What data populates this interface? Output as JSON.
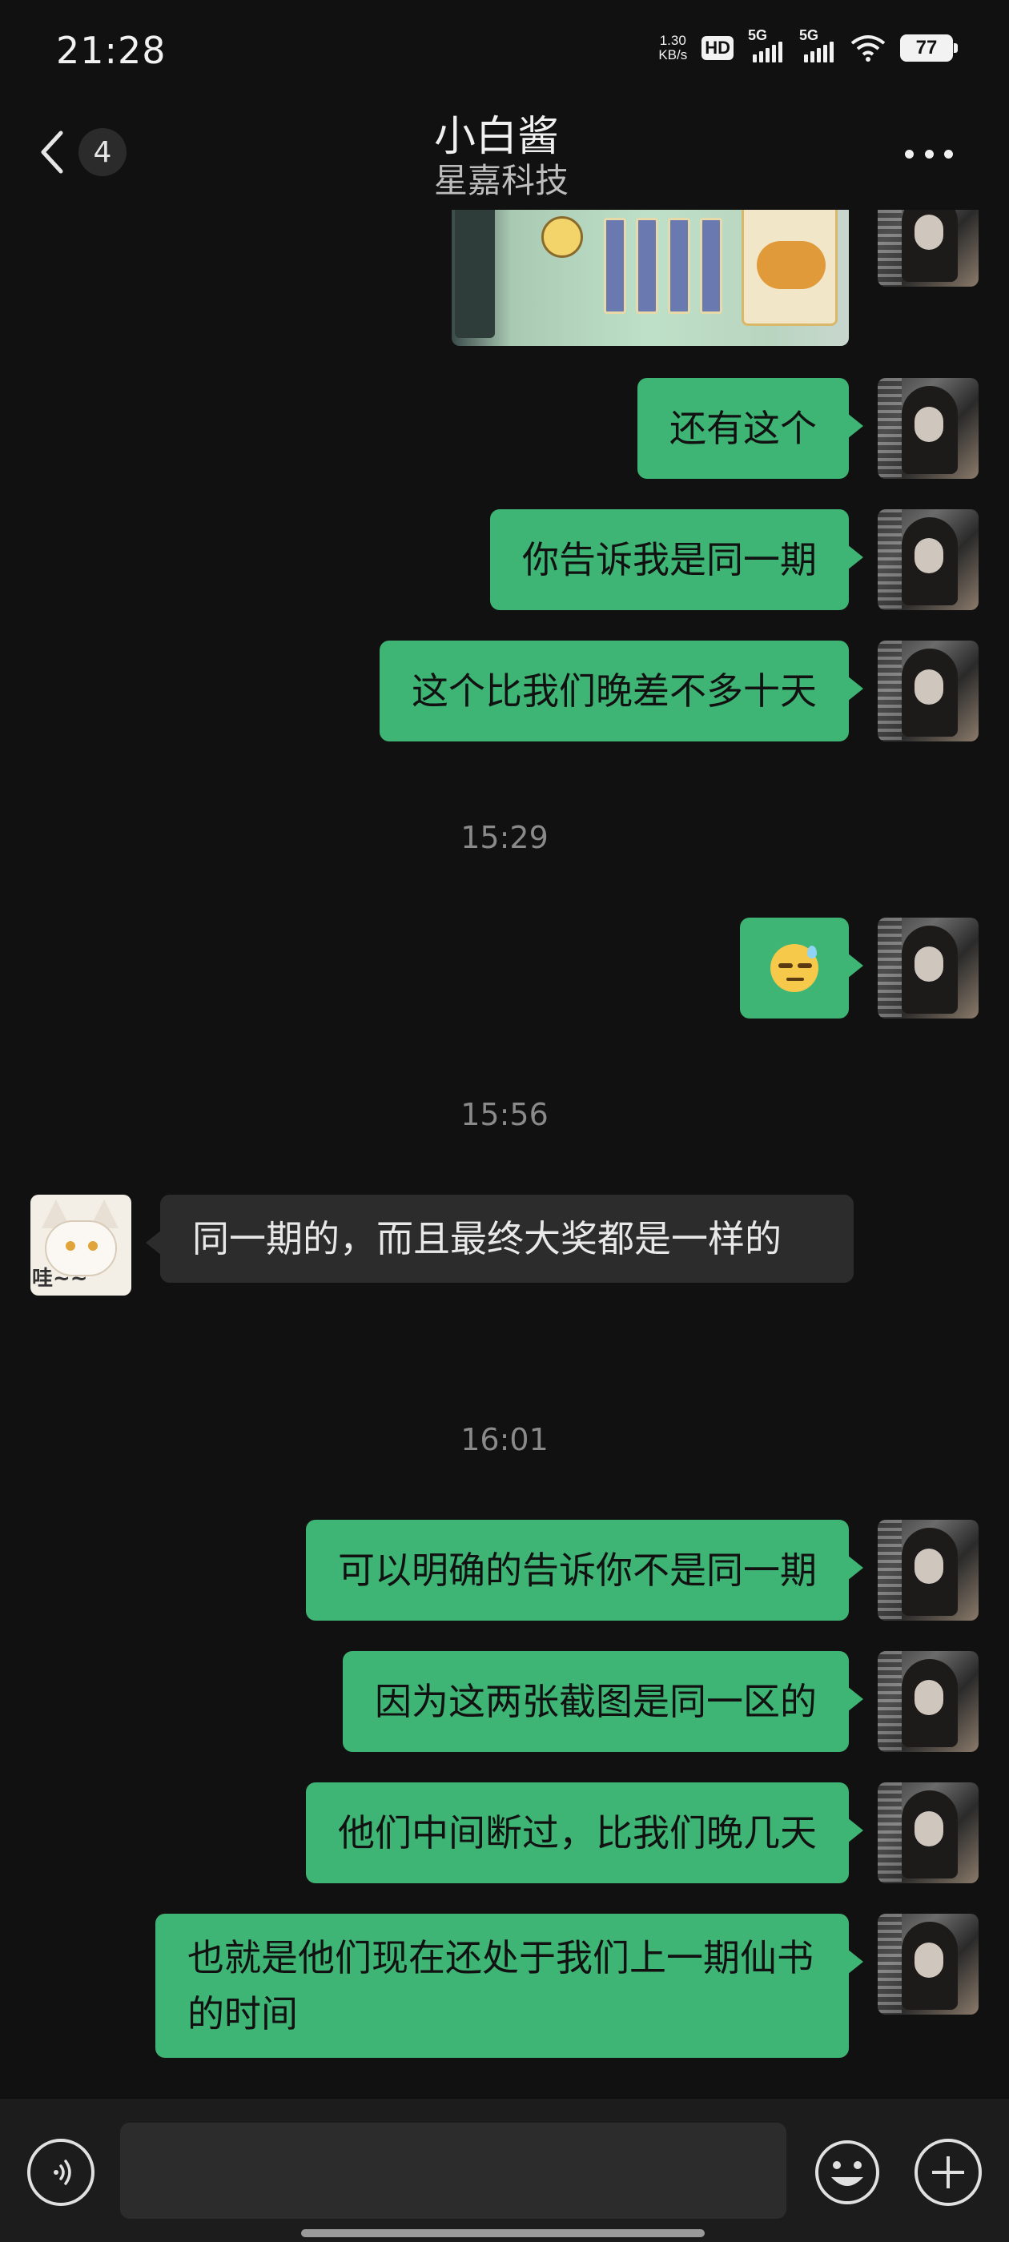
{
  "status_bar": {
    "time": "21:28",
    "net_speed_value": "1.30",
    "net_speed_unit": "KB/s",
    "hd_label": "HD",
    "sim1_label": "5G",
    "sim2_label": "5G",
    "battery": "77"
  },
  "header": {
    "unread_count": "4",
    "title": "小白酱",
    "subtitle": "星嘉科技"
  },
  "messages": [
    {
      "type": "image",
      "from": "me",
      "description_icon": "game-screenshot-image"
    },
    {
      "type": "text",
      "from": "me",
      "text": "还有这个"
    },
    {
      "type": "text",
      "from": "me",
      "text": "你告诉我是同一期"
    },
    {
      "type": "text",
      "from": "me",
      "text": "这个比我们晚差不多十天"
    },
    {
      "type": "time",
      "text": "15:29"
    },
    {
      "type": "emoji",
      "from": "me",
      "icon": "sweat-smile-emoji-icon"
    },
    {
      "type": "time",
      "text": "15:56"
    },
    {
      "type": "text",
      "from": "other",
      "text": "同一期的，而且最终大奖都是一样的"
    },
    {
      "type": "time",
      "text": "16:01"
    },
    {
      "type": "text",
      "from": "me",
      "text": "可以明确的告诉你不是同一期"
    },
    {
      "type": "text",
      "from": "me",
      "text": "因为这两张截图是同一区的"
    },
    {
      "type": "text",
      "from": "me",
      "text": "他们中间断过，比我们晚几天"
    },
    {
      "type": "text",
      "from": "me",
      "text": "也就是他们现在还处于我们上一期仙书的时间"
    }
  ],
  "input_bar": {
    "placeholder": "",
    "icons": [
      "voice-icon",
      "emoji-icon",
      "plus-icon"
    ]
  },
  "colors": {
    "background": "#111111",
    "my_bubble": "#3eb575",
    "other_bubble": "#2c2c2c",
    "timestamp": "#8a8a8a"
  }
}
